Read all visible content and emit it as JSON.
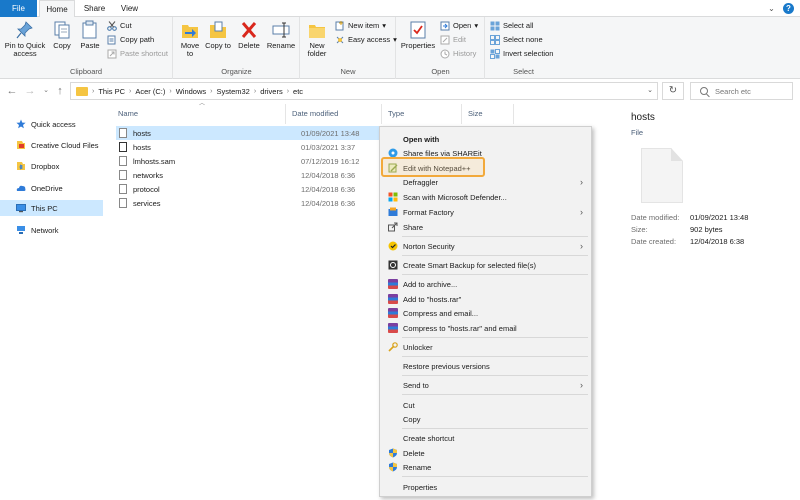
{
  "ribbon": {
    "tabs": [
      "File",
      "Home",
      "Share",
      "View"
    ],
    "clipboard": {
      "label": "Clipboard",
      "pin_label": "Pin to Quick access",
      "copy_label": "Copy",
      "paste_label": "Paste",
      "cut_label": "Cut",
      "copy_path_label": "Copy path",
      "paste_shortcut_label": "Paste shortcut"
    },
    "organize": {
      "label": "Organize",
      "move_to_label": "Move to",
      "copy_to_label": "Copy to",
      "delete_label": "Delete",
      "rename_label": "Rename"
    },
    "new": {
      "label": "New",
      "new_folder_label": "New folder",
      "new_item_label": "New item",
      "easy_access_label": "Easy access"
    },
    "open": {
      "label": "Open",
      "properties_label": "Properties",
      "open_label": "Open",
      "edit_label": "Edit",
      "history_label": "History"
    },
    "select": {
      "label": "Select",
      "select_all_label": "Select all",
      "select_none_label": "Select none",
      "invert_label": "Invert selection"
    }
  },
  "address": {
    "breadcrumbs": [
      "This PC",
      "Acer (C:)",
      "Windows",
      "System32",
      "drivers",
      "etc"
    ],
    "search_placeholder": "Search etc"
  },
  "nav": {
    "items": [
      {
        "label": "Quick access",
        "icon": "star-icon"
      },
      {
        "label": "Creative Cloud Files",
        "icon": "creative-cloud-icon"
      },
      {
        "label": "Dropbox",
        "icon": "dropbox-icon"
      },
      {
        "label": "OneDrive",
        "icon": "onedrive-icon"
      },
      {
        "label": "This PC",
        "icon": "computer-icon"
      },
      {
        "label": "Network",
        "icon": "network-icon"
      }
    ]
  },
  "files": {
    "columns": [
      "Name",
      "Date modified",
      "Type",
      "Size"
    ],
    "rows": [
      {
        "name": "hosts",
        "date": "01/09/2021 13:48"
      },
      {
        "name": "hosts",
        "date": "01/03/2021 3:37"
      },
      {
        "name": "lmhosts.sam",
        "date": "07/12/2019 16:12"
      },
      {
        "name": "networks",
        "date": "12/04/2018 6:36"
      },
      {
        "name": "protocol",
        "date": "12/04/2018 6:36"
      },
      {
        "name": "services",
        "date": "12/04/2018 6:36"
      }
    ]
  },
  "details": {
    "title": "hosts",
    "type": "File",
    "date_modified_key": "Date modified:",
    "date_modified_value": "01/09/2021 13:48",
    "size_key": "Size:",
    "size_value": "902 bytes",
    "date_created_key": "Date created:",
    "date_created_value": "12/04/2018 6:38"
  },
  "context_menu": {
    "items": [
      "Open with",
      "Share files via SHAREit",
      "Edit with Notepad++",
      "Defraggler",
      "Scan with Microsoft Defender...",
      "Format Factory",
      "Share",
      "Norton Security",
      "Create Smart Backup for selected file(s)",
      "Add to archive...",
      "Add to \"hosts.rar\"",
      "Compress and email...",
      "Compress to \"hosts.rar\" and email",
      "Unlocker",
      "Restore previous versions",
      "Send to",
      "Cut",
      "Copy",
      "Create shortcut",
      "Delete",
      "Rename",
      "Properties"
    ]
  },
  "colors": {
    "accent": "#1979ca",
    "selection": "#cce8ff",
    "highlight_border": "#f2a93b"
  }
}
